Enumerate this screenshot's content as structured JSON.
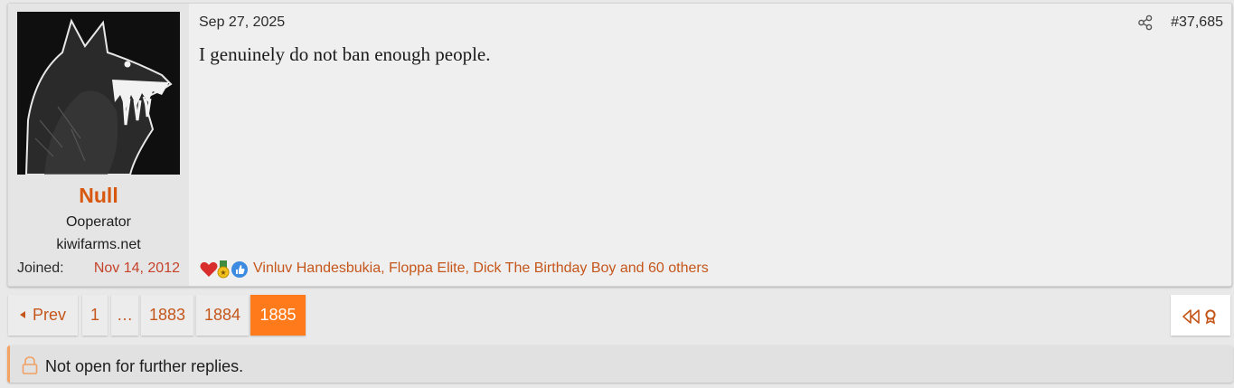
{
  "post": {
    "date": "Sep 27, 2025",
    "number": "#37,685",
    "body": "I genuinely do not ban enough people.",
    "user": {
      "name": "Null",
      "title": "Ooperator",
      "banner": "kiwifarms.net",
      "joined_label": "Joined:",
      "joined_date": "Nov 14, 2012"
    },
    "reactions": {
      "icons": [
        "heart-icon",
        "medal-icon",
        "thumbs-up-icon"
      ],
      "text": "Vinluv Handesbukia, Floppa Elite, Dick The Birthday Boy and 60 others"
    }
  },
  "pagination": {
    "prev_label": "Prev",
    "pages": [
      "1",
      "…",
      "1883",
      "1884",
      "1885"
    ],
    "current": "1885"
  },
  "notice": {
    "text": "Not open for further replies."
  },
  "colors": {
    "accent": "#ff7a1a",
    "link": "#c5561b",
    "username": "#d8580f"
  }
}
